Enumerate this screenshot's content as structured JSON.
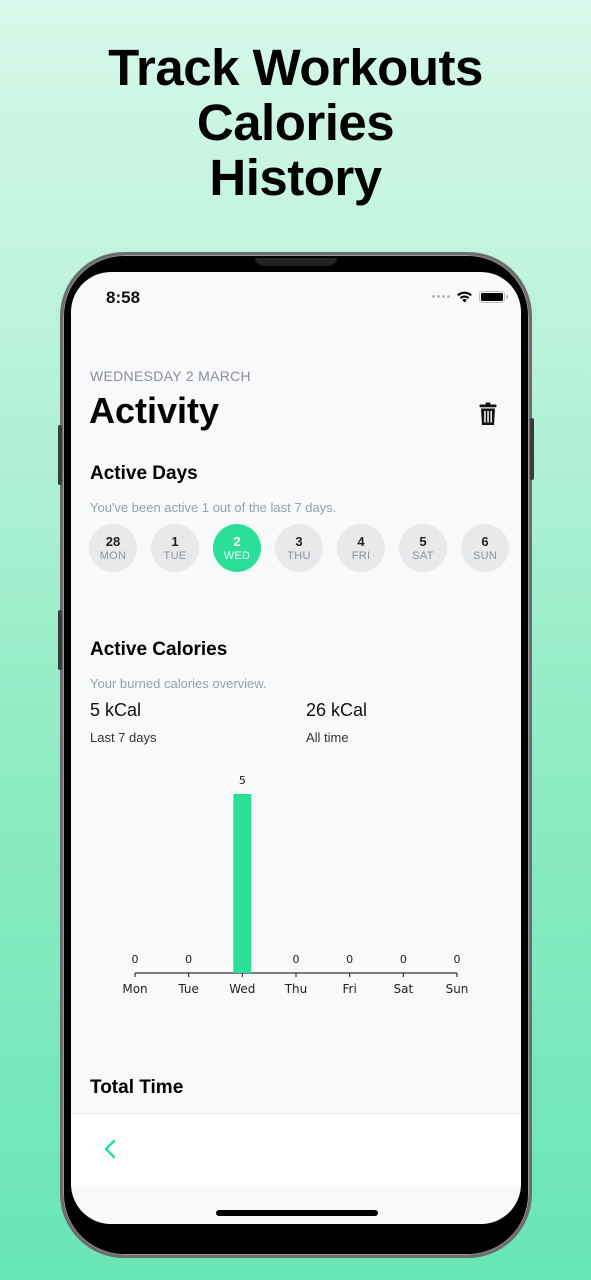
{
  "promo": {
    "headline_lines": [
      "Track Workouts",
      "Calories",
      "History"
    ]
  },
  "status_bar": {
    "time": "8:58",
    "icons": [
      "signal-dots-icon",
      "wifi-icon",
      "battery-icon"
    ]
  },
  "header": {
    "date": "WEDNESDAY 2 MARCH",
    "title": "Activity",
    "action_icon": "trash-icon"
  },
  "active_days": {
    "title": "Active Days",
    "subtitle": "You've been active 1 out of the last 7 days.",
    "days": [
      {
        "num": "28",
        "name": "MON",
        "active": false
      },
      {
        "num": "1",
        "name": "TUE",
        "active": false
      },
      {
        "num": "2",
        "name": "WED",
        "active": true
      },
      {
        "num": "3",
        "name": "THU",
        "active": false
      },
      {
        "num": "4",
        "name": "FRI",
        "active": false
      },
      {
        "num": "5",
        "name": "SAT",
        "active": false
      },
      {
        "num": "6",
        "name": "SUN",
        "active": false
      }
    ]
  },
  "active_calories": {
    "title": "Active Calories",
    "subtitle": "Your burned calories overview.",
    "stats": [
      {
        "value": "5 kCal",
        "label": "Last 7 days"
      },
      {
        "value": "26 kCal",
        "label": "All time"
      }
    ]
  },
  "chart_data": {
    "type": "bar",
    "title": "",
    "xlabel": "",
    "ylabel": "",
    "categories": [
      "Mon",
      "Tue",
      "Wed",
      "Thu",
      "Fri",
      "Sat",
      "Sun"
    ],
    "values": [
      0,
      0,
      5,
      0,
      0,
      0,
      0
    ],
    "ylim": [
      0,
      5
    ],
    "grid": false,
    "data_labels": true,
    "bar_color": "#2bdf98"
  },
  "total_time": {
    "title": "Total Time"
  },
  "tab_bar": {
    "back_icon": "chevron-left-icon"
  },
  "colors": {
    "accent": "#2bdf98",
    "background_top": "#d6f8ea",
    "background_bottom": "#68e6b6"
  }
}
